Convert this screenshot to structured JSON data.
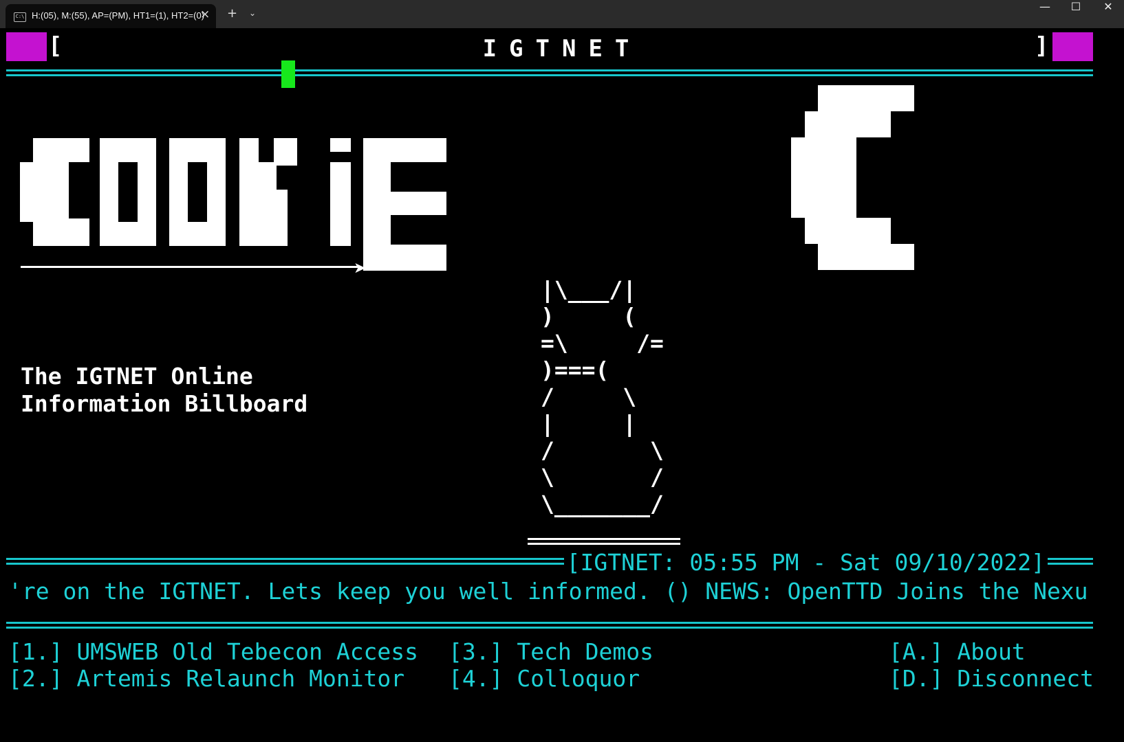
{
  "window": {
    "tab_title": "H:(05), M:(55), AP=(PM), HT1=(1), HT2=(0)",
    "tab_icon": "C:\\",
    "close_tab_icon": "×",
    "new_tab_icon": "+",
    "dropdown_icon": "⌄",
    "minimize_icon": "—",
    "maximize_icon": "☐",
    "close_icon": "✕"
  },
  "header": {
    "title": "IGTNET",
    "left_bracket": "[",
    "right_bracket": "]"
  },
  "logo": {
    "word": "COOKIE"
  },
  "subtitle": "The IGTNET Online\nInformation Billboard",
  "cat_art": "|\\___/|\n)     (\n=\\     /=\n)===(\n/     \\\n|     |\n/       \\\n\\       /\n\\_______/",
  "status": {
    "text": "[IGTNET: 05:55 PM - Sat 09/10/2022]"
  },
  "ticker": "'re on the IGTNET. Lets keep you well informed. () NEWS: OpenTTD Joins the Nexu",
  "menu": {
    "item1": "[1.] UMSWEB Old Tebecon Access",
    "item2": "[2.] Artemis Relaunch Monitor",
    "item3": "[3.] Tech Demos",
    "item4": "[4.] Colloquor",
    "itemA": "[A.] About",
    "itemD": "[D.] Disconnect"
  },
  "colors": {
    "accent": "#1ed1d6",
    "magenta": "#c412d0",
    "cursor": "#17e81c",
    "background": "#000000"
  }
}
